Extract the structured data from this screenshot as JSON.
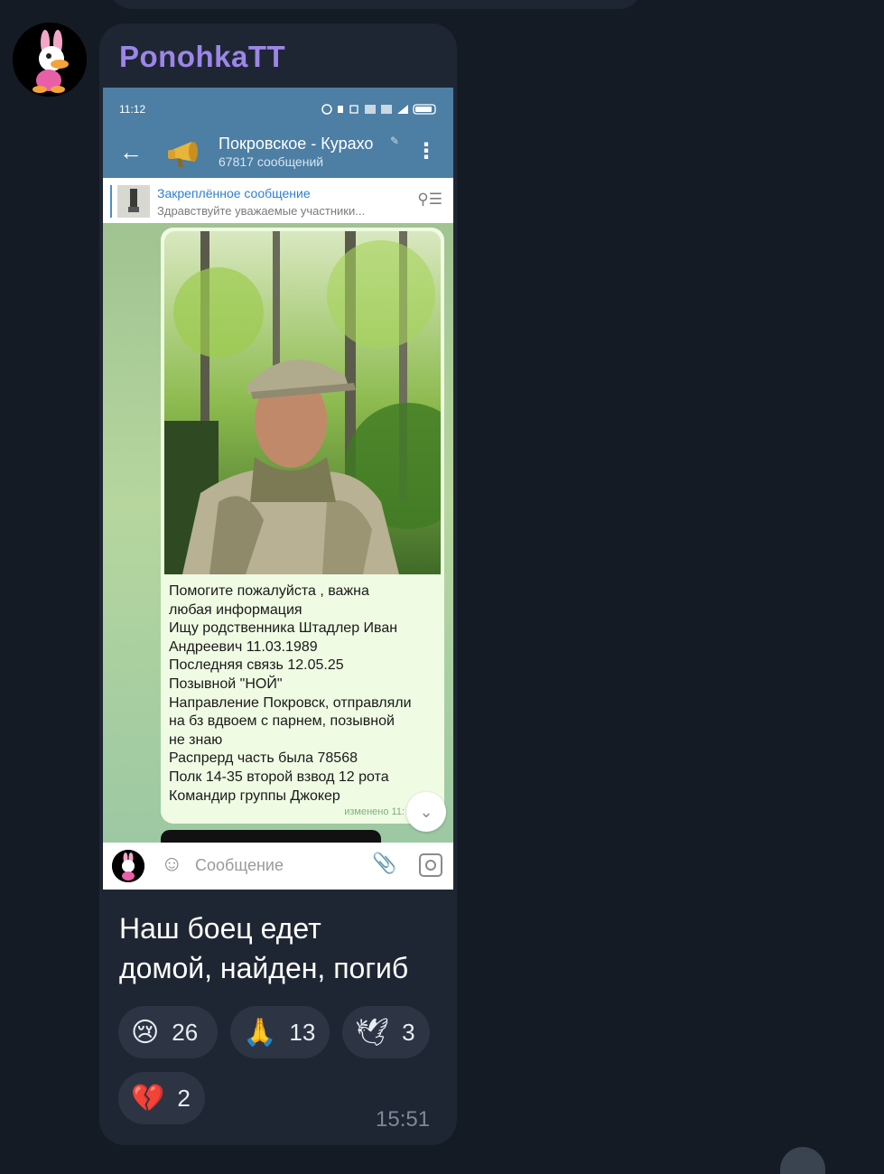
{
  "message": {
    "sender": "PonohkaTT",
    "caption_lines": [
      "Наш боец едет",
      "домой, найден, погиб"
    ],
    "time": "15:51",
    "reactions": [
      {
        "icon": "crying-face-icon",
        "emoji": "😢",
        "count": "26"
      },
      {
        "icon": "folded-hands-icon",
        "emoji": "🙏",
        "count": "13"
      },
      {
        "icon": "dove-icon",
        "emoji": "🕊",
        "count": "3"
      },
      {
        "icon": "broken-heart-icon",
        "emoji": "💔",
        "count": "2"
      }
    ]
  },
  "screenshot": {
    "status_time": "11:12",
    "channel_title": "Покровское - Курахо",
    "channel_subtitle": "67817 сообщений",
    "pinned_title": "Закреплённое сообщение",
    "pinned_text": "Здравствуйте уважаемые участники...",
    "post_lines": [
      "Помогите пожалуйста , важна",
      "любая информация",
      "Ищу родственника Штадлер Иван",
      "Андреевич 11.03.1989",
      "Последняя связь 12.05.25",
      "Позывной \"НОЙ\"",
      "Направление Покровск, отправляли",
      "на бз вдвоем с парнем, позывной",
      "не знаю",
      "Распрерд часть была 78568",
      "Полк 14-35 второй взвод 12 рота",
      "Командир группы Джокер"
    ],
    "edited_label": "изменено 11:",
    "input_placeholder": "Сообщение"
  }
}
